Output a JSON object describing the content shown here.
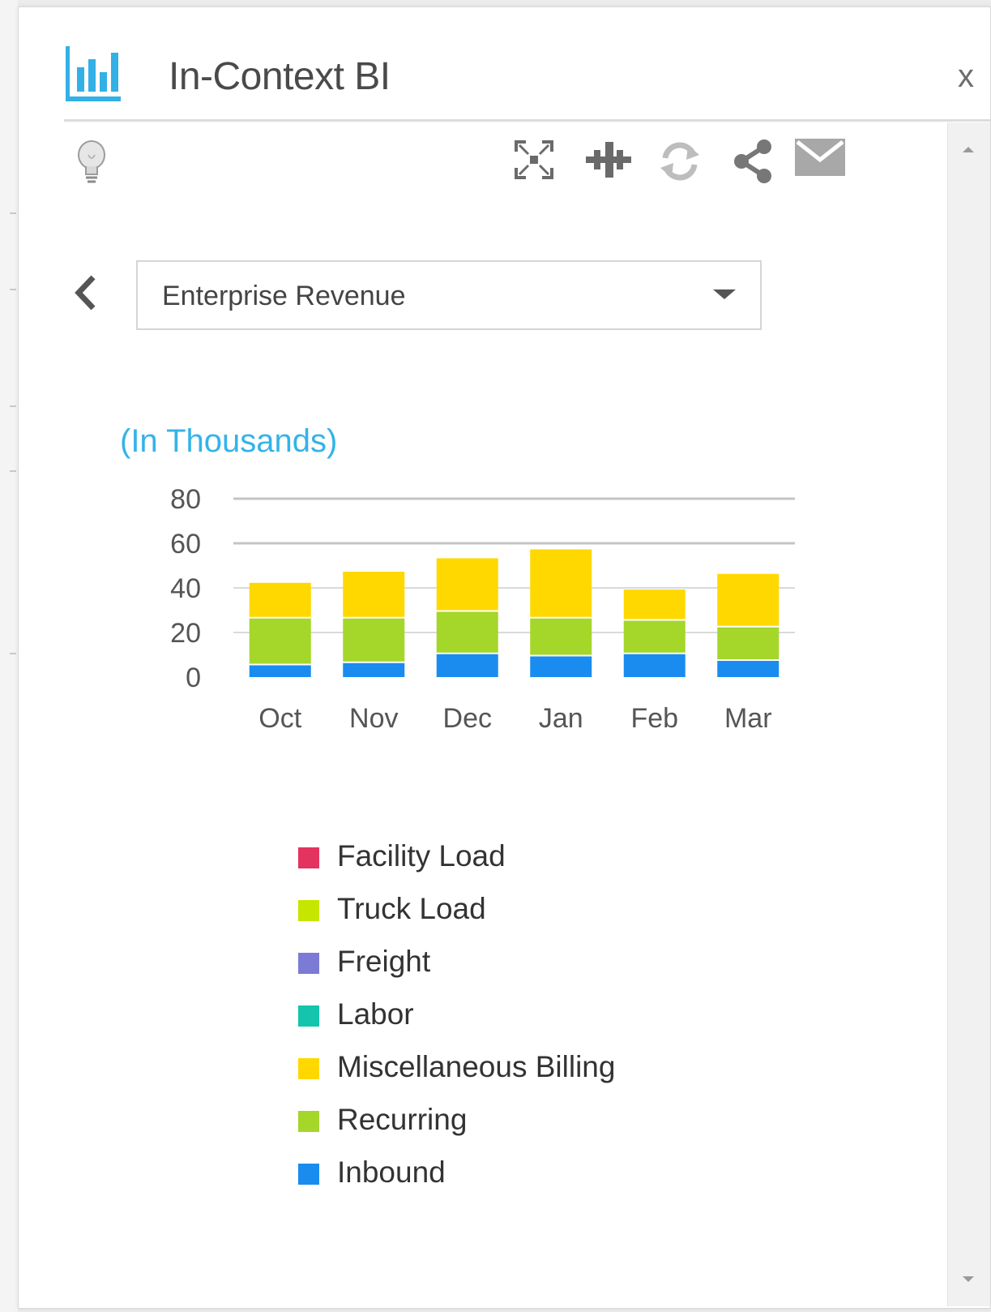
{
  "window": {
    "title": "In-Context BI",
    "close_label": "x"
  },
  "toolbar": {
    "icons": [
      "expand-icon",
      "pin-icon",
      "refresh-icon",
      "share-icon",
      "mail-icon"
    ]
  },
  "report_select": {
    "selected": "Enterprise Revenue"
  },
  "chart_data": {
    "type": "bar",
    "stacked": true,
    "title": "(In Thousands)",
    "categories": [
      "Oct",
      "Nov",
      "Dec",
      "Jan",
      "Feb",
      "Mar"
    ],
    "ylim": [
      0,
      80
    ],
    "yticks": [
      0,
      20,
      40,
      60,
      80
    ],
    "grid": true,
    "series": [
      {
        "name": "Inbound",
        "color": "#1a8cf0",
        "values": [
          6,
          7,
          11,
          10,
          11,
          8
        ]
      },
      {
        "name": "Recurring",
        "color": "#a5d62a",
        "values": [
          21,
          20,
          19,
          17,
          15,
          15
        ]
      },
      {
        "name": "Miscellaneous Billing",
        "color": "#ffd800",
        "values": [
          16,
          21,
          24,
          31,
          14,
          24
        ]
      }
    ]
  },
  "legend": [
    {
      "label": "Facility Load",
      "color": "#e4335f"
    },
    {
      "label": "Truck Load",
      "color": "#c6e600"
    },
    {
      "label": "Freight",
      "color": "#7b7bd6"
    },
    {
      "label": "Labor",
      "color": "#14c4ac"
    },
    {
      "label": "Miscellaneous Billing",
      "color": "#ffd800"
    },
    {
      "label": "Recurring",
      "color": "#a5d62a"
    },
    {
      "label": "Inbound",
      "color": "#1a8cf0"
    }
  ]
}
